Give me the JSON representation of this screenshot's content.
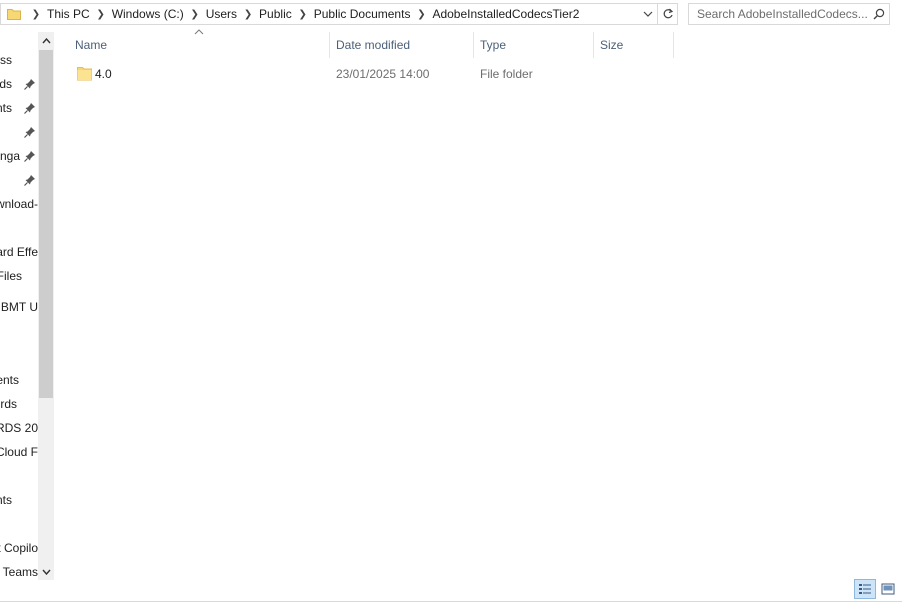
{
  "address_bar": {
    "breadcrumbs": [
      "This PC",
      "Windows (C:)",
      "Users",
      "Public",
      "Public Documents",
      "AdobeInstalledCodecsTier2"
    ]
  },
  "search": {
    "placeholder": "Search AdobeInstalledCodecs..."
  },
  "nav_pane": {
    "items": [
      {
        "label": "ss",
        "pinned": false
      },
      {
        "label": "ds",
        "pinned": true
      },
      {
        "label": "nts",
        "pinned": true
      },
      {
        "label": "",
        "pinned": true
      },
      {
        "label": "nga",
        "pinned": true
      },
      {
        "label": "",
        "pinned": true
      },
      {
        "label": "wnload-",
        "pinned": false
      },
      {
        "label": "",
        "pinned": false
      },
      {
        "label": "ard Effe",
        "pinned": false
      },
      {
        "label": "Files",
        "pinned": false
      },
      {
        "label": "BMT U",
        "pinned": false
      },
      {
        "label": "",
        "pinned": false
      },
      {
        "label": "",
        "pinned": false
      },
      {
        "label": "ents",
        "pinned": false
      },
      {
        "label": "rds",
        "pinned": false
      },
      {
        "label": "ARDS 20",
        "pinned": false
      },
      {
        "label": "Cloud F",
        "pinned": false
      },
      {
        "label": "",
        "pinned": false
      },
      {
        "label": "nts",
        "pinned": false
      },
      {
        "label": "",
        "pinned": false
      },
      {
        "label": "t Copilo",
        "pinned": false
      },
      {
        "label": "t Teams",
        "pinned": false
      }
    ]
  },
  "columns": {
    "name": "Name",
    "date_modified": "Date modified",
    "type": "Type",
    "size": "Size"
  },
  "files": [
    {
      "name": "4.0",
      "date_modified": "23/01/2025 14:00",
      "type": "File folder",
      "size": ""
    }
  ],
  "colors": {
    "header_text": "#4c607a",
    "folder_yellow": "#f8d775",
    "selected_view_bg": "#cce4f7"
  }
}
